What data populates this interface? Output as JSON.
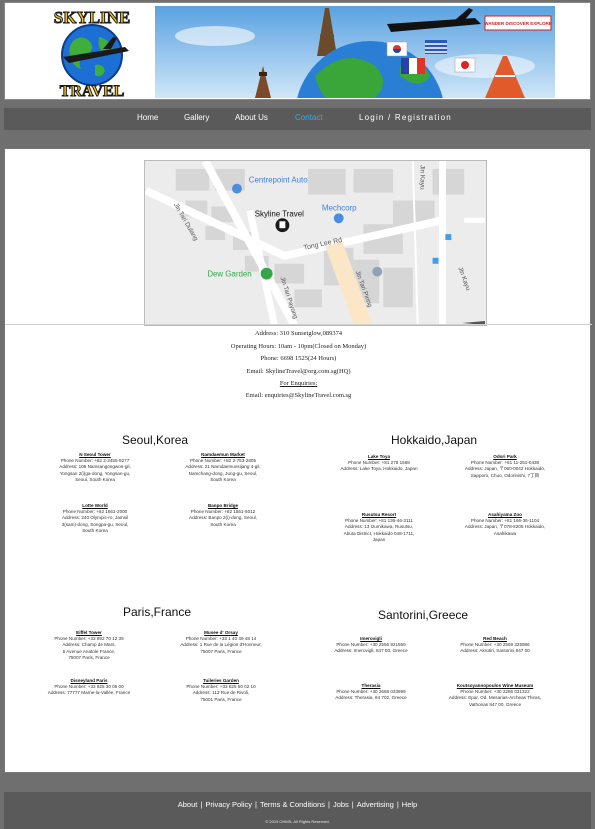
{
  "header": {
    "logo_top_text": "SKYLINE",
    "logo_bottom_text": "TRAVEL",
    "banner_sign": "WANDER DISCOVER EXPLORE"
  },
  "nav": {
    "home": "Home",
    "gallery": "Gallery",
    "about": "About Us",
    "contact": "Contact",
    "login": "Login / Registration"
  },
  "map": {
    "labels": {
      "centrepoint": "Centrepoint Auto",
      "mechcorp": "Mechcorp",
      "skyline": "Skyline Travel",
      "dew": "Dew Garden",
      "jin_tari_duliang": "Jln Tari Dulang",
      "tong_lee": "Tong Lee Rd",
      "jin_tari_payong": "Jln Tari Payong",
      "jin_tari_piring": "Jln Tari Piring",
      "jin_kayu_1": "Jln Kayu",
      "jin_kayu_2": "Jln Kayu"
    }
  },
  "contact": {
    "address": "Address: 310 Sunsetglow,089374",
    "hours": "Operating Hours: 10am - 10pm(Closed on Monday)",
    "phone": "Phone: 6698 1525(24 Hours)",
    "email": "Email: SkylineTravel@org.com.sg(HQ)",
    "enquiries_heading": "For Enquiries:",
    "enquiries_email": "Email: enquiries@SkylineTravel.com.sg"
  },
  "regions": {
    "seoul": {
      "title": "Seoul,Korea",
      "places": [
        {
          "name": "N Seoul Tower",
          "lines": [
            "Phone Number: +82 2-3455-9277",
            "Address: 105 Namsangongwon-gil,",
            "Yongsan 2(i)ga-dong, Yongsan-gu,",
            "Seoul, South Korea"
          ]
        },
        {
          "name": "Namdaemun Market",
          "lines": [
            "Phone Number: +82 2-753-2805",
            "Address: 21 Namdaemunsijang 4-gil,",
            "Namchang-dong, Jung-gu, Seoul,",
            "South Korea"
          ]
        },
        {
          "name": "Lotte World",
          "lines": [
            "Phone Number: +82 1661-2000",
            "Address: 240 Olympic-ro, Jamsil",
            "3(sam)-dong, Songpa-gu, Seoul,",
            "South Korea"
          ]
        },
        {
          "name": "Banpo Bridge",
          "lines": [
            "Phone Number: +82 1551-5012",
            "Address: Banpo 2(i)-dong, Seoul,",
            "South Korea"
          ]
        }
      ]
    },
    "hokkaido": {
      "title": "Hokkaido,Japan",
      "places": [
        {
          "name": "Lake Toya",
          "lines": [
            "Phone Number: +81 278 1568",
            "Address: Lake Toya, Hokkaido, Japan"
          ]
        },
        {
          "name": "Odori Park",
          "lines": [
            "Phone Number: +81 11-251-0438",
            "Address: Japan, 〒060-0042 Hokkaido,",
            "Sapporo, Chuo, Odorinishi, 7丁目"
          ]
        },
        {
          "name": "Rusutsu Resort",
          "lines": [
            "Phone Number: +81 136-46-3111",
            "Address: 13 Izumikawa, Rusutsu,",
            "Abuta District, Hokkaido 048-1711,",
            "Japan"
          ]
        },
        {
          "name": "Asahiyama Zoo",
          "lines": [
            "Phone Number: +81 166-36-1104",
            "Address: Japan, 〒078-8205 Hokkaido,",
            "Asahikawa"
          ]
        }
      ]
    },
    "paris": {
      "title": "Paris,France",
      "places": [
        {
          "name": "Eiffel Tower",
          "lines": [
            "Phone Number: +33 892 70 12 39",
            "Address: Champ de Mars,",
            "5 Avenue Anatole France,",
            "75007 Paris, France"
          ]
        },
        {
          "name": "Musee d' Orsay",
          "lines": [
            "Phone Number: +33 1 40 49 48 14",
            "Address: 1 Rue de la Légion d'Honneur,",
            "75007 Paris, France"
          ]
        },
        {
          "name": "Disneyland Paris",
          "lines": [
            "Phone Number: +33 825 30 05 00",
            "Address: 77777 Marne-la-Vallée, France"
          ]
        },
        {
          "name": "Tuileries Garden",
          "lines": [
            "Phone Number: +33 825 50 02 10",
            "Address: 113 Rue de Rivoli,",
            "75001 Paris, France"
          ]
        }
      ]
    },
    "santorini": {
      "title": "Santorini,Greece",
      "places": [
        {
          "name": "Imerovigli",
          "lines": [
            "Phone Number: +30 2556 921559",
            "Address: Imerovigli, 847 00, Greece"
          ]
        },
        {
          "name": "Red Beach",
          "lines": [
            "Phone Number: +30 2569 325986",
            "Address: Akrotiri, Santorini 847 00"
          ]
        },
        {
          "name": "Therasia",
          "lines": [
            "Phone Number: +30 2668 033699",
            "Address: Therasia, 84 702, Greece"
          ]
        },
        {
          "name": "Koutsoyannopoulos Wine Museum",
          "lines": [
            "Phone Number: +30 2286 031322",
            "Address: Epar. Od. Mesarias-Archeas Thiras,",
            "Vathonas 847 00, Greece"
          ]
        }
      ]
    }
  },
  "footer": {
    "links": [
      "About",
      "Privacy Policy",
      "Terms & Conditions",
      "Jobs",
      "Advertising",
      "Help"
    ],
    "separator": "|",
    "copyright": "© 2019 OHMS, All Rights Reserved."
  }
}
